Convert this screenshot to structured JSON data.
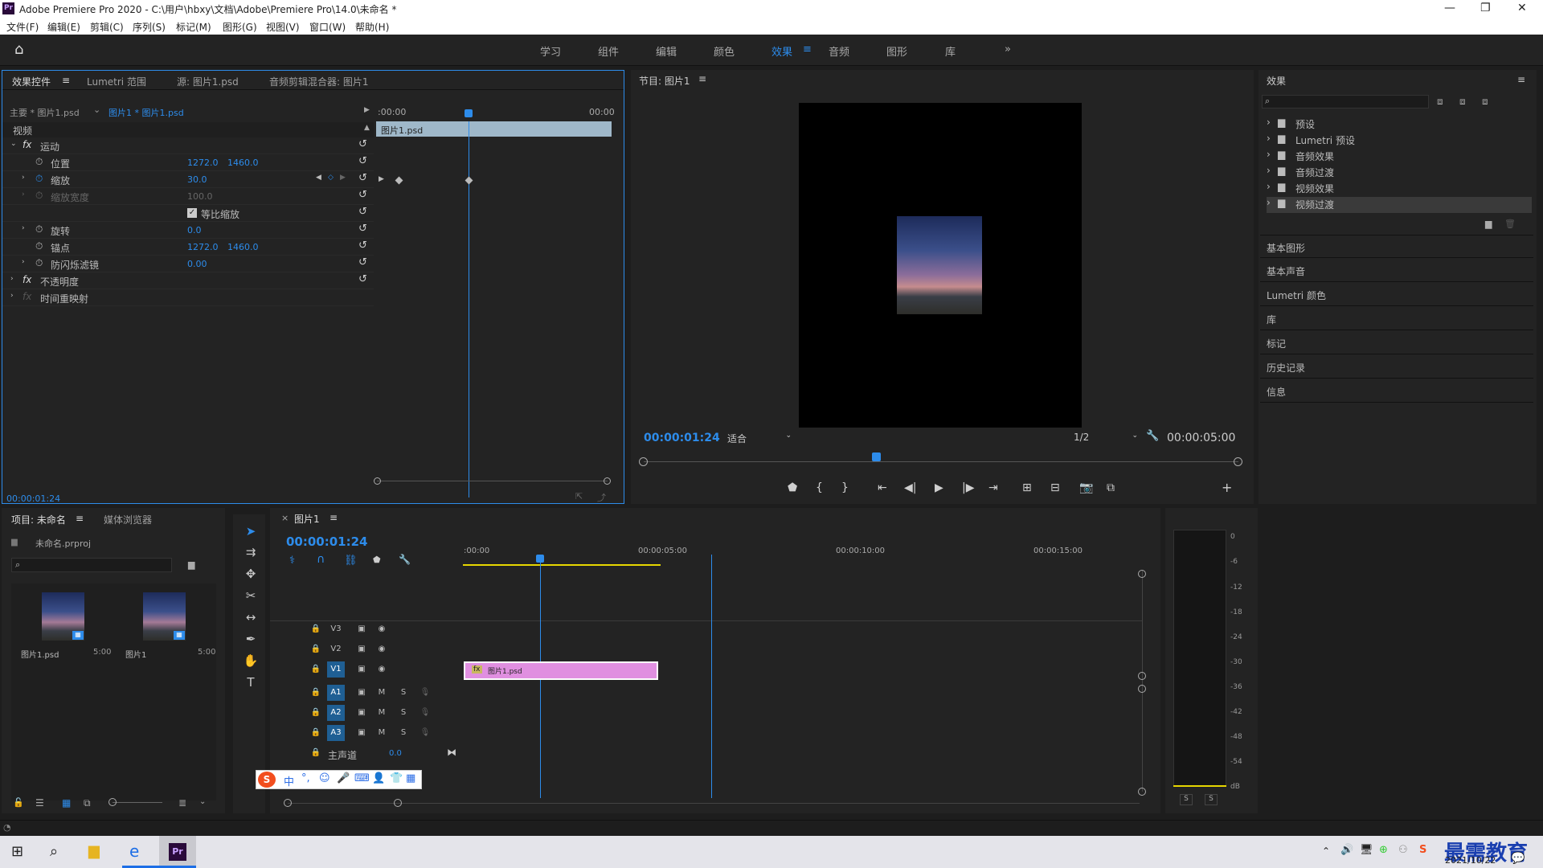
{
  "window": {
    "title": "Adobe Premiere Pro 2020 - C:\\用户\\hbxy\\文档\\Adobe\\Premiere Pro\\14.0\\未命名 *",
    "app_badge": "Pr"
  },
  "menu": [
    "文件(F)",
    "编辑(E)",
    "剪辑(C)",
    "序列(S)",
    "标记(M)",
    "图形(G)",
    "视图(V)",
    "窗口(W)",
    "帮助(H)"
  ],
  "workspaces": [
    "学习",
    "组件",
    "编辑",
    "颜色",
    "效果",
    "音频",
    "图形",
    "库"
  ],
  "workspace_active": "效果",
  "workspace_more": "»",
  "effect_controls": {
    "tabs": [
      "效果控件",
      "Lumetri 范围",
      "源: 图片1.psd",
      "音频剪辑混合器: 图片1"
    ],
    "master": "主要 * 图片1.psd",
    "clip": "图片1 * 图片1.psd",
    "mini_start": ":00:00",
    "mini_end": "00:00",
    "mini_clip": "图片1.psd",
    "section": "视频",
    "rows": [
      {
        "label": "运动",
        "fx": "fx"
      },
      {
        "label": "位置",
        "v1": "1272.0",
        "v2": "1460.0"
      },
      {
        "label": "缩放",
        "v1": "30.0"
      },
      {
        "label": "缩放宽度",
        "v1": "100.0"
      },
      {
        "label": "等比缩放"
      },
      {
        "label": "旋转",
        "v1": "0.0"
      },
      {
        "label": "锚点",
        "v1": "1272.0",
        "v2": "1460.0"
      },
      {
        "label": "防闪烁滤镜",
        "v1": "0.00"
      },
      {
        "label": "不透明度",
        "fx": "fx"
      },
      {
        "label": "时间重映射",
        "fx": "fx"
      }
    ],
    "timecode": "00:00:01:24"
  },
  "program": {
    "title": "节目: 图片1",
    "timecode": "00:00:01:24",
    "fit": "适合",
    "resolution": "1/2",
    "duration": "00:00:05:00",
    "playhead_fraction": 0.39
  },
  "effects": {
    "title": "效果",
    "items": [
      "预设",
      "Lumetri 预设",
      "音频效果",
      "音频过渡",
      "视频效果",
      "视频过渡"
    ],
    "selected": "视频过渡",
    "sections": [
      "基本图形",
      "基本声音",
      "Lumetri 颜色",
      "库",
      "标记",
      "历史记录",
      "信息"
    ]
  },
  "project": {
    "tabs": [
      "项目: 未命名",
      "媒体浏览器"
    ],
    "file": "未命名.prproj",
    "items": [
      {
        "name": "图片1.psd",
        "dur": "5:00"
      },
      {
        "name": "图片1",
        "dur": "5:00"
      }
    ]
  },
  "timeline": {
    "tab": "图片1",
    "timecode": "00:00:01:24",
    "ruler": [
      ":00:00",
      "00:00:05:00",
      "00:00:10:00",
      "00:00:15:00"
    ],
    "video_tracks": [
      "V3",
      "V2",
      "V1"
    ],
    "audio_tracks": [
      "A1",
      "A2",
      "A3"
    ],
    "master": "主声道",
    "master_value": "0.0",
    "clip": "图片1.psd",
    "clip_fx": "fx",
    "mute": "M",
    "solo": "S"
  },
  "meter": {
    "scale": [
      "0",
      "-6",
      "-12",
      "-18",
      "-24",
      "-30",
      "-36",
      "-42",
      "-48",
      "-54",
      "dB"
    ],
    "solo": [
      "S",
      "S"
    ]
  },
  "ime": {
    "logo": "S",
    "mode": "中"
  },
  "taskbar": {
    "date": "2021/10/22",
    "watermark": "最需教育",
    "app": "Pr"
  },
  "colors": {
    "accent": "#2d8ceb",
    "clip": "#e08fe0",
    "playhead": "#2d8ceb",
    "workarea": "#e6d600"
  }
}
